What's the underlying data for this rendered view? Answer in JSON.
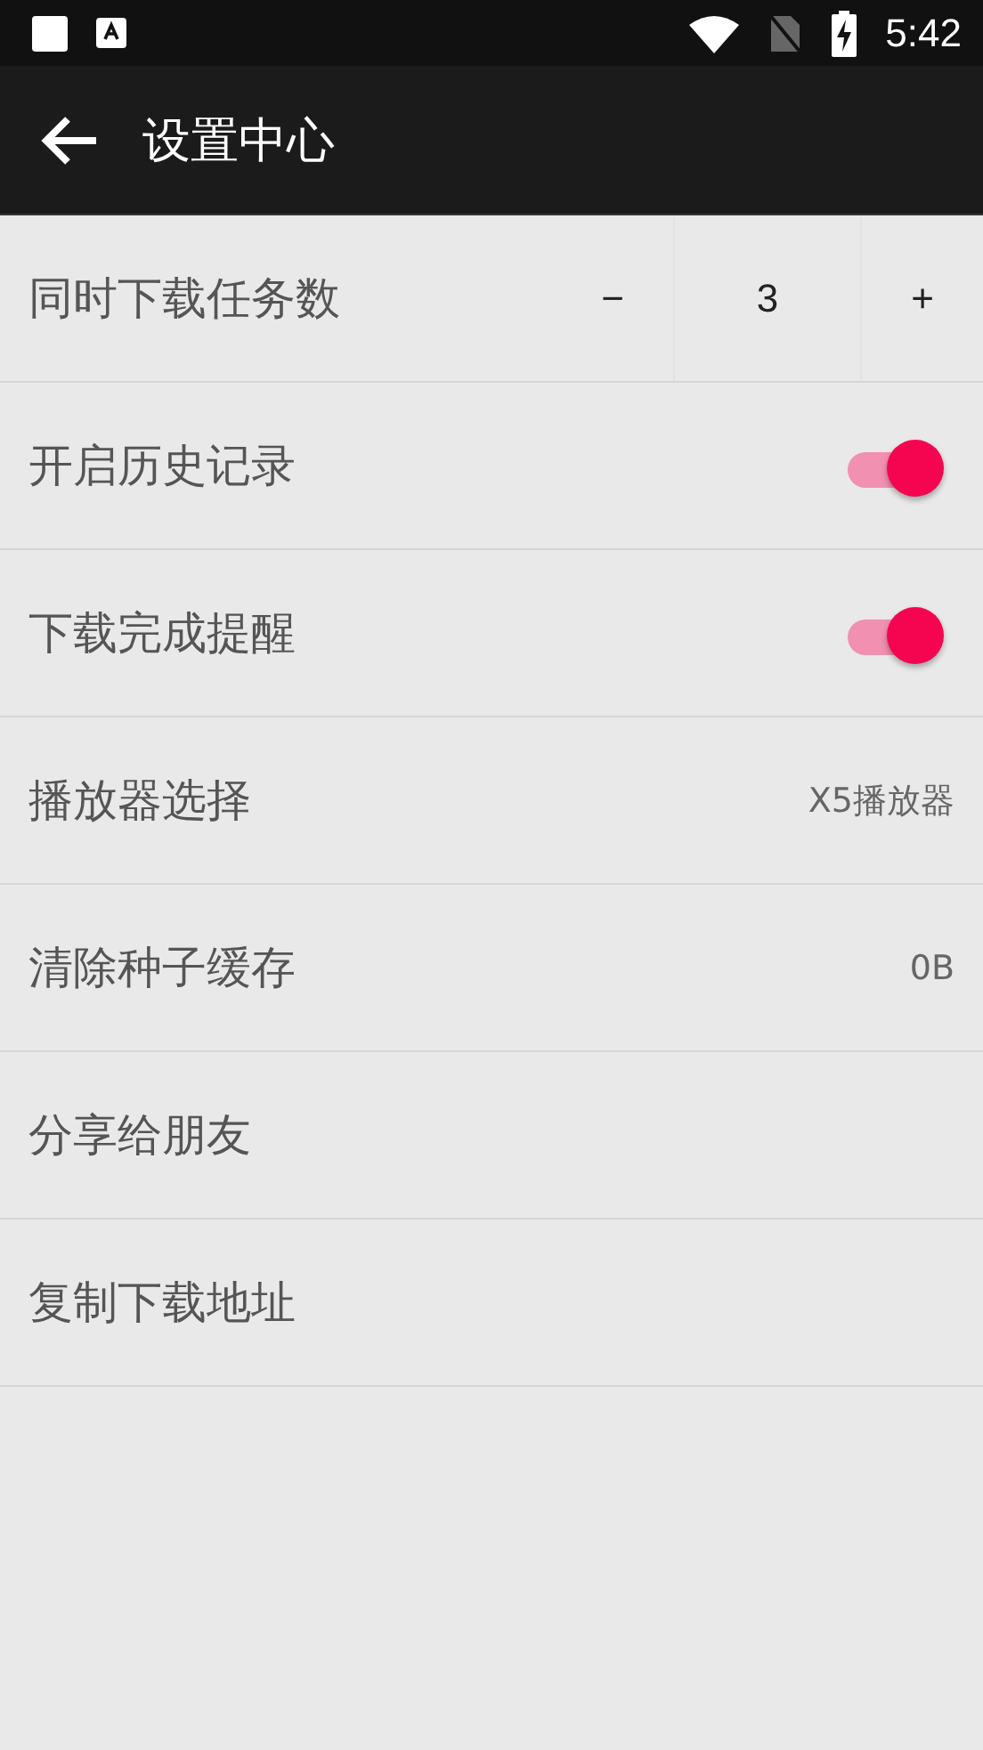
{
  "status_bar": {
    "time": "5:42"
  },
  "toolbar": {
    "title": "设置中心"
  },
  "settings": [
    {
      "kind": "stepper",
      "label": "同时下载任务数",
      "decrement": "−",
      "value": "3",
      "increment": "+"
    },
    {
      "kind": "toggle",
      "label": "开启历史记录",
      "on": true
    },
    {
      "kind": "toggle",
      "label": "下载完成提醒",
      "on": true
    },
    {
      "kind": "value",
      "label": "播放器选择",
      "value": "X5播放器"
    },
    {
      "kind": "value",
      "label": "清除种子缓存",
      "value": "0B"
    },
    {
      "kind": "plain",
      "label": "分享给朋友"
    },
    {
      "kind": "plain",
      "label": "复制下载地址"
    }
  ]
}
